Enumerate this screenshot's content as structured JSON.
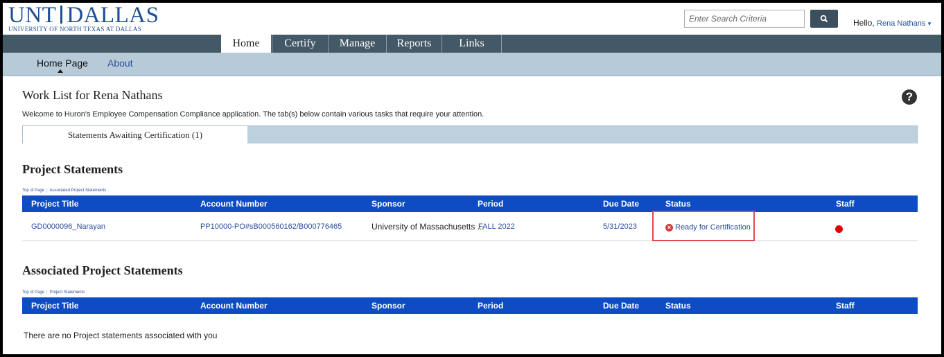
{
  "header": {
    "logo_main_left": "UNT",
    "logo_main_right": "DALLAS",
    "logo_sub": "UNIVERSITY OF NORTH TEXAS AT DALLAS",
    "search_placeholder": "Enter Search Criteria",
    "greeting": "Hello,",
    "user_name": "Rena Nathans"
  },
  "main_nav": {
    "tabs": [
      {
        "label": "Home",
        "active": true
      },
      {
        "label": "Certify",
        "active": false
      },
      {
        "label": "Manage",
        "active": false
      },
      {
        "label": "Reports",
        "active": false
      },
      {
        "label": "Links",
        "active": false
      }
    ]
  },
  "sub_nav": {
    "items": [
      {
        "label": "Home Page",
        "active": true
      },
      {
        "label": "About",
        "active": false
      }
    ]
  },
  "page": {
    "title": "Work List for Rena Nathans",
    "welcome": "Welcome to Huron's Employee Compensation Compliance application. The tab(s) below contain various tasks that require your attention.",
    "tab_label": "Statements Awaiting Certification (1)"
  },
  "project_statements": {
    "title": "Project Statements",
    "crumb_top": "Top of Page",
    "crumb_link": "Associated Project Statements",
    "columns": [
      "Project Title",
      "Account Number",
      "Sponsor",
      "Period",
      "Due Date",
      "Status",
      "Staff"
    ],
    "rows": [
      {
        "project_title": "GD0000096_Narayan",
        "account_number": "PP10000-PO#sB000560162/B000776465",
        "sponsor": "University of Massachusetts ...",
        "period": "FALL 2022",
        "due_date": "5/31/2023",
        "status": "Ready for Certification",
        "staff_color": "#e00000"
      }
    ]
  },
  "associated_statements": {
    "title": "Associated Project Statements",
    "crumb_top": "Top of Page",
    "crumb_link": "Project Statements",
    "columns": [
      "Project Title",
      "Account Number",
      "Sponsor",
      "Period",
      "Due Date",
      "Status",
      "Staff"
    ],
    "empty_message": "There are no Project statements associated with you"
  },
  "colors": {
    "brand": "#1d4f91",
    "nav_bg": "#445968",
    "subnav_bg": "#b7cad8",
    "table_header": "#0d4cc2",
    "status_highlight": "#e04a4a"
  }
}
